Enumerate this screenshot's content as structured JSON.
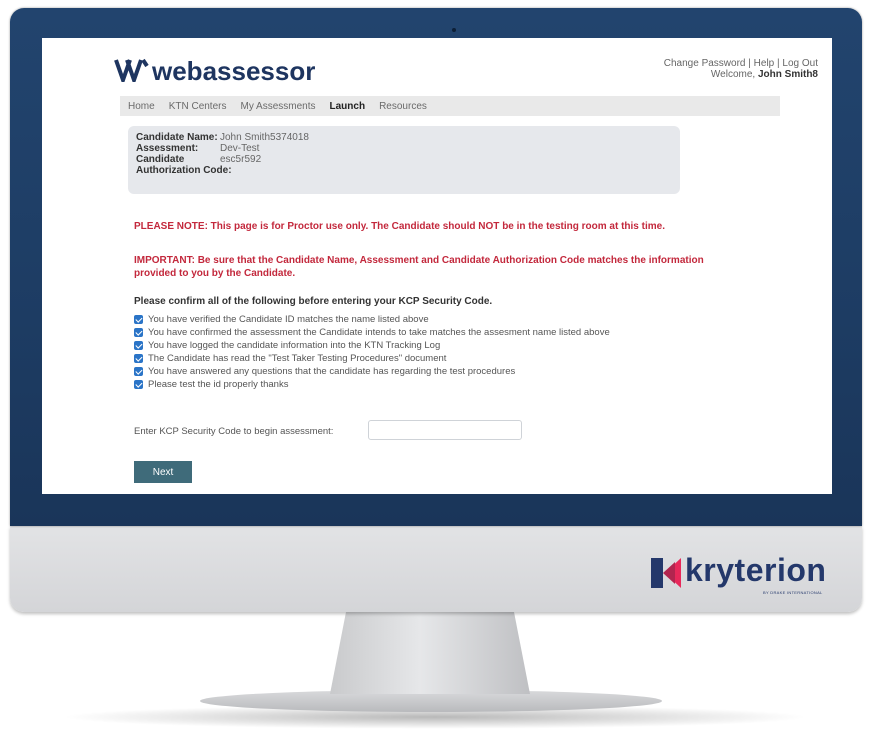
{
  "header": {
    "logo_text": "webassessor",
    "links": [
      "Change Password",
      "Help",
      "Log Out"
    ],
    "welcome_prefix": "Welcome,",
    "welcome_name": "John Smith8"
  },
  "nav": {
    "items": [
      "Home",
      "KTN Centers",
      "My Assessments",
      "Launch",
      "Resources"
    ],
    "active": "Launch"
  },
  "candidate_info": {
    "rows": [
      {
        "label": "Candidate Name:",
        "value": "John Smith5374018"
      },
      {
        "label": "Assessment:",
        "value": "Dev-Test"
      },
      {
        "label": "Candidate",
        "value": "esc5r592"
      },
      {
        "label": "Authorization Code:",
        "value": ""
      }
    ]
  },
  "notes": {
    "please_note": "PLEASE NOTE: This page is for Proctor use only. The Candidate should NOT be in the testing room at this time.",
    "important_line1": "IMPORTANT: Be sure that the Candidate Name, Assessment and Candidate Authorization Code matches the information",
    "important_line2": "provided to you by the Candidate."
  },
  "confirm": {
    "heading": "Please confirm all of the following before entering your KCP Security Code.",
    "items": [
      "You have verified the Candidate ID matches the name listed above",
      "You have confirmed the assessment the Candidate intends to take matches the assesment name listed above",
      "You have logged the candidate information into the KTN Tracking Log",
      "The Candidate has read the \"Test Taker Testing Procedures\" document",
      "You have answered any questions that the candidate has regarding the test procedures",
      "Please test the id properly thanks"
    ]
  },
  "security": {
    "label": "Enter KCP Security Code to begin assessment:",
    "value": "",
    "next_label": "Next"
  },
  "brand": {
    "name": "kryterion",
    "sub": "BY DRAKE INTERNATIONAL"
  },
  "colors": {
    "bezel": "#1d3c63",
    "accent_blue": "#2a74c7",
    "warning_red": "#c3283c",
    "button": "#3f6b7a",
    "brand_pink": "#e8285a"
  }
}
